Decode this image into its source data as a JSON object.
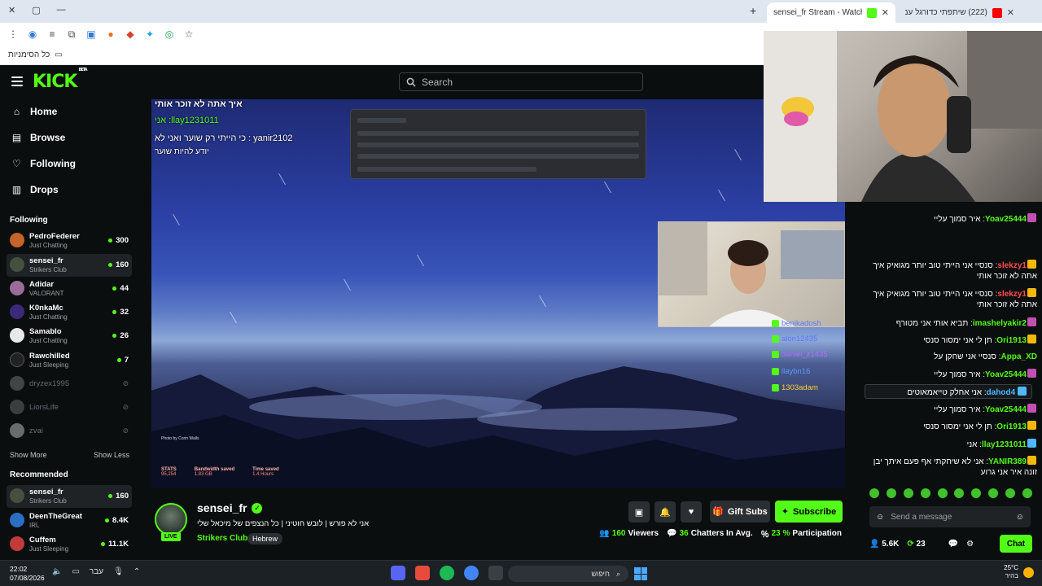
{
  "browser": {
    "tabs": [
      {
        "title": "sensei_fr Stream - Watch Live o",
        "active": true
      },
      {
        "title": "(222) שיתפתי כדורגל עם כל הס",
        "active": false
      }
    ],
    "bookmarks_label": "כל הסימניות"
  },
  "header": {
    "logo": "KICK",
    "logo_badge": "BETA",
    "search_placeholder": "Search"
  },
  "sidebar": {
    "nav": [
      {
        "label": "Home",
        "icon": "home-icon"
      },
      {
        "label": "Browse",
        "icon": "browse-icon"
      },
      {
        "label": "Following",
        "icon": "heart-icon"
      },
      {
        "label": "Drops",
        "icon": "drops-icon"
      }
    ],
    "following_title": "Following",
    "following": [
      {
        "name": "PedroFederer",
        "sub": "Just Chatting",
        "viewers": "300",
        "online": true
      },
      {
        "name": "sensei_fr",
        "sub": "Strikers Club",
        "viewers": "160",
        "online": true,
        "selected": true
      },
      {
        "name": "Adidar",
        "sub": "VALORANT",
        "viewers": "44",
        "online": true
      },
      {
        "name": "K0nkaMc",
        "sub": "Just Chatting",
        "viewers": "32",
        "online": true
      },
      {
        "name": "Samablo",
        "sub": "Just Chatting",
        "viewers": "26",
        "online": true
      },
      {
        "name": "Rawchilled",
        "sub": "Just Sleeping",
        "viewers": "7",
        "online": true
      },
      {
        "name": "dryzex1995",
        "sub": "",
        "viewers": "",
        "online": false
      },
      {
        "name": "LiorsLife",
        "sub": "",
        "viewers": "",
        "online": false
      },
      {
        "name": "zvai",
        "sub": "",
        "viewers": "",
        "online": false
      }
    ],
    "show_more": "Show More",
    "show_less": "Show Less",
    "recommended_title": "Recommended",
    "recommended": [
      {
        "name": "sensei_fr",
        "sub": "Strikers Club",
        "viewers": "160"
      },
      {
        "name": "DeenTheGreat",
        "sub": "IRL",
        "viewers": "8.4K"
      },
      {
        "name": "Cuffem",
        "sub": "Just Sleeping",
        "viewers": "11.1K"
      }
    ]
  },
  "player_overlay": {
    "line1": "איך אתה לא זוכר אותי",
    "line2": "llay1231011: אני",
    "line3": "yanir2102 : כי הייתי רק שוער ואני לא",
    "line4": "יודע להיות שוער",
    "chat_users": [
      "benikadosh",
      "alon12435",
      "daniel_z1435",
      "llaybn16",
      "1303adam"
    ],
    "stats": [
      {
        "value": "95,254",
        "label": "STATS"
      },
      {
        "value": "1.83 GB",
        "label": "Bandwidth saved"
      },
      {
        "value": "1.4 Hours",
        "label": "Time saved"
      }
    ],
    "photo_credit": "Photo by Corin Walls"
  },
  "stream": {
    "streamer": "sensei_fr",
    "live_label": "LIVE",
    "title": "אני לא פורש | לובש חוטיני | כל הנצפים של מיכאל שלי",
    "category": "Strikers Club",
    "tag": "Hebrew",
    "gift_label": "Gift Subs",
    "subscribe_label": "Subscribe",
    "viewers": "160",
    "viewers_label": "Viewers",
    "chatters": "36",
    "chatters_label": "Chatters In Avg.",
    "participation": "23 %",
    "participation_label": "Participation"
  },
  "chat": {
    "messages": [
      {
        "user": "Yoav25444",
        "text": "איר סמוך עליי",
        "color": "#53fc18"
      },
      {
        "user": "slekzy1",
        "text": "סנסיי אני הייתי טוב יותר מגואיק איך אתה לא זוכר אותי",
        "color": "#ff4d4d"
      },
      {
        "user": "slekzy1",
        "text": "סנסיי אני הייתי טוב יותר מגואיק איך אתה לא זוכר אותי",
        "color": "#ff4d4d"
      },
      {
        "user": "imashelyakir2",
        "text": "תביא אותי אני מטורף",
        "color": "#53fc18"
      },
      {
        "user": "Ori1913",
        "text": "תן לי אני ימסור סנסי",
        "color": "#53fc18"
      },
      {
        "user": "Appa_XD",
        "text": "סנסיי אני שחקן על",
        "color": "#53fc18"
      },
      {
        "user": "Yoav25444",
        "text": "איר סמוך עליי",
        "color": "#53fc18"
      },
      {
        "user": "dahod4",
        "text": "אני אחלק טייאמאוטים",
        "color": "#4fb8ff"
      },
      {
        "user": "Yoav25444",
        "text": "איר סמוך עליי",
        "color": "#53fc18"
      },
      {
        "user": "Ori1913",
        "text": "תן לי אני ימסור סנסי",
        "color": "#53fc18"
      },
      {
        "user": "llay1231011",
        "text": "אני",
        "color": "#53fc18"
      },
      {
        "user": "YANIR389",
        "text": "אני לא שיחקתי אף פעם איתך יבן זונה איר אני גרוע",
        "color": "#53fc18"
      }
    ],
    "input_placeholder": "Send a message",
    "followers": "5.6K",
    "points": "23",
    "chat_button": "Chat"
  },
  "taskbar": {
    "time": "22:02",
    "date": "07/08/2026",
    "lang": "עבר",
    "search_label": "חיפוש",
    "temp": "25°C",
    "weather": "בהיר"
  }
}
